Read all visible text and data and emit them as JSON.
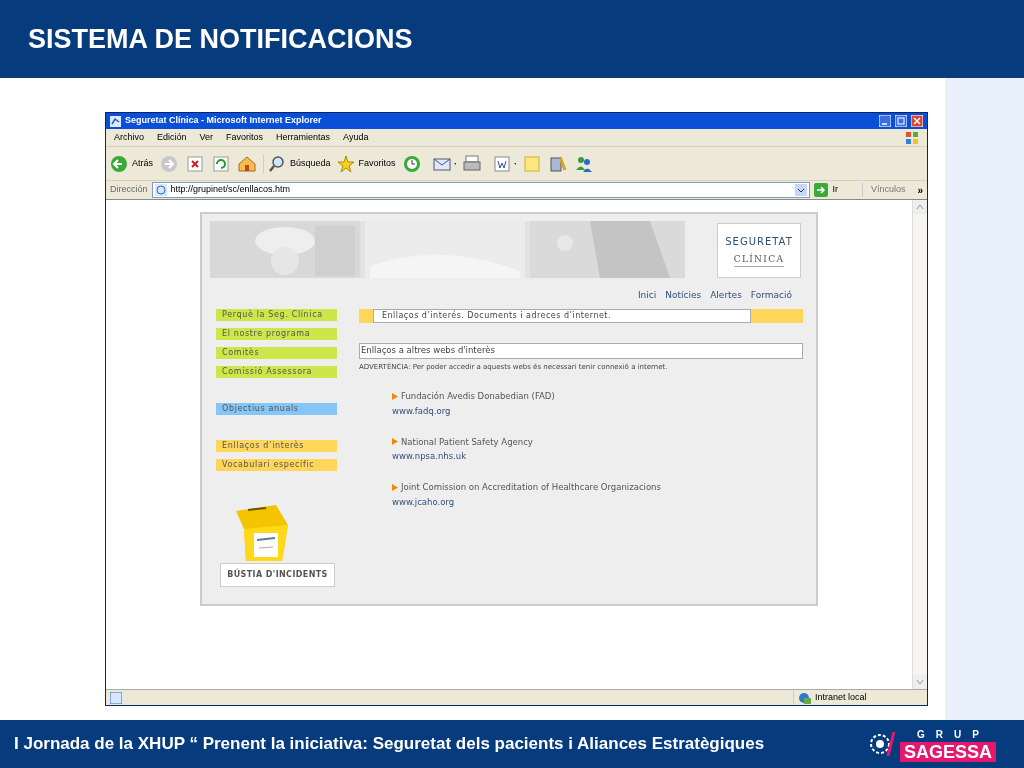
{
  "slide": {
    "title": "SISTEMA DE NOTIFICACIONS",
    "footer": "I Jornada de la XHUP “ Prenent la iniciativa: Seguretat dels pacients i Aliances Estratègiques",
    "logo_top": "GRUP",
    "logo_name": "SAGESSA"
  },
  "browser": {
    "title": "Seguretat Clínica - Microsoft Internet Explorer",
    "menu": [
      "Archivo",
      "Edición",
      "Ver",
      "Favoritos",
      "Herramientas",
      "Ayuda"
    ],
    "back": "Atrás",
    "search": "Búsqueda",
    "favorites": "Favoritos",
    "address_label": "Dirección",
    "url": "http://grupinet/sc/enllacos.htm",
    "go": "Ir",
    "links": "Vínculos",
    "links_more": "»",
    "status": "Intranet local"
  },
  "page": {
    "logo": [
      "SEGURETAT",
      "CLÍNICA"
    ],
    "nav": [
      "Inici",
      "Notícies",
      "Alertes",
      "Formació"
    ],
    "side_menu": [
      {
        "label": "Perquè la Seg. Clínica",
        "color": "#cde64a"
      },
      {
        "label": "El nostre programa",
        "color": "#cde64a"
      },
      {
        "label": "Comitès",
        "color": "#cde64a"
      },
      {
        "label": "Comissió Assessora",
        "color": "#cde64a"
      },
      {
        "label": "Objectius anuals",
        "color": "#85c6f6"
      },
      {
        "label": "Enllaços d’interès",
        "color": "#ffd65a"
      },
      {
        "label": "Vocabulari específic",
        "color": "#ffd65a"
      }
    ],
    "heading": "Enllaços d’interés. Documents i adreces d’internet.",
    "section": "Enllaços a altres webs d'interès",
    "warning": "ADVERTÈNCIA: Per poder accedir a aquests webs és necessari tenir connexió a internet.",
    "links": [
      {
        "name": "Fundación Avedis Donabedian (FAD)",
        "url": "www.fadq.org"
      },
      {
        "name": "National Patient Safety Agency",
        "url": "www.npsa.nhs.uk"
      },
      {
        "name": "Joint Comission on Accreditation of Healthcare Organizacions",
        "url": "www.jcaho.org"
      }
    ],
    "mailbox": "BÚSTIA D'INCIDENTS"
  }
}
